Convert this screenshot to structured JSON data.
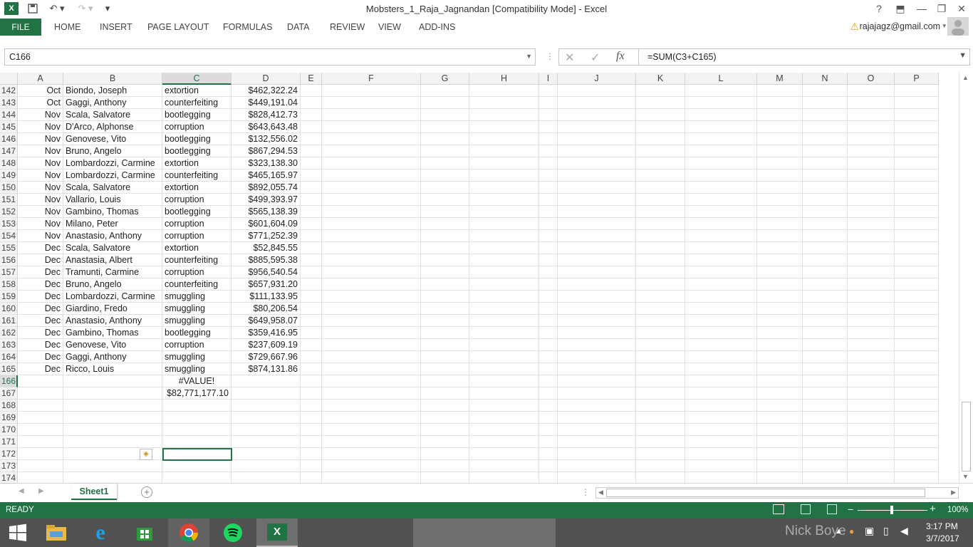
{
  "title_bar": {
    "title": "Mobsters_1_Raja_Jagnandan  [Compatibility Mode] - Excel",
    "help": "?",
    "colors": {
      "accent": "#217346"
    }
  },
  "ribbon": {
    "file_label": "FILE",
    "tabs": [
      "HOME",
      "INSERT",
      "PAGE LAYOUT",
      "FORMULAS",
      "DATA",
      "REVIEW",
      "VIEW",
      "ADD-INS"
    ],
    "account": "rajajagz@gmail.com"
  },
  "formula_bar": {
    "name_box": "C166",
    "fx": "fx",
    "formula": "=SUM(C3+C165)"
  },
  "grid": {
    "columns": [
      "A",
      "B",
      "C",
      "D",
      "E",
      "F",
      "G",
      "H",
      "I",
      "J",
      "K",
      "L",
      "M",
      "N",
      "O",
      "P"
    ],
    "selected_column": "C",
    "rows": [
      {
        "num": "142",
        "a": "Oct",
        "b": "Biondo, Joseph",
        "c": "extortion",
        "d": "$462,322.24"
      },
      {
        "num": "143",
        "a": "Oct",
        "b": "Gaggi, Anthony",
        "c": "counterfeiting",
        "d": "$449,191.04"
      },
      {
        "num": "144",
        "a": "Nov",
        "b": "Scala, Salvatore",
        "c": "bootlegging",
        "d": "$828,412.73"
      },
      {
        "num": "145",
        "a": "Nov",
        "b": "D'Arco, Alphonse",
        "c": "corruption",
        "d": "$643,643.48"
      },
      {
        "num": "146",
        "a": "Nov",
        "b": "Genovese, Vito",
        "c": "bootlegging",
        "d": "$132,556.02"
      },
      {
        "num": "147",
        "a": "Nov",
        "b": "Bruno, Angelo",
        "c": "bootlegging",
        "d": "$867,294.53"
      },
      {
        "num": "148",
        "a": "Nov",
        "b": "Lombardozzi, Carmine",
        "c": "extortion",
        "d": "$323,138.30"
      },
      {
        "num": "149",
        "a": "Nov",
        "b": "Lombardozzi, Carmine",
        "c": "counterfeiting",
        "d": "$465,165.97"
      },
      {
        "num": "150",
        "a": "Nov",
        "b": "Scala, Salvatore",
        "c": "extortion",
        "d": "$892,055.74"
      },
      {
        "num": "151",
        "a": "Nov",
        "b": "Vallario, Louis",
        "c": "corruption",
        "d": "$499,393.97"
      },
      {
        "num": "152",
        "a": "Nov",
        "b": "Gambino, Thomas",
        "c": "bootlegging",
        "d": "$565,138.39"
      },
      {
        "num": "153",
        "a": "Nov",
        "b": "Milano, Peter",
        "c": "corruption",
        "d": "$601,604.09"
      },
      {
        "num": "154",
        "a": "Nov",
        "b": "Anastasio, Anthony",
        "c": "corruption",
        "d": "$771,252.39"
      },
      {
        "num": "155",
        "a": "Dec",
        "b": "Scala, Salvatore",
        "c": "extortion",
        "d": "$52,845.55"
      },
      {
        "num": "156",
        "a": "Dec",
        "b": "Anastasia, Albert",
        "c": "counterfeiting",
        "d": "$885,595.38"
      },
      {
        "num": "157",
        "a": "Dec",
        "b": "Tramunti, Carmine",
        "c": "corruption",
        "d": "$956,540.54"
      },
      {
        "num": "158",
        "a": "Dec",
        "b": "Bruno, Angelo",
        "c": "counterfeiting",
        "d": "$657,931.20"
      },
      {
        "num": "159",
        "a": "Dec",
        "b": "Lombardozzi, Carmine",
        "c": "smuggling",
        "d": "$111,133.95"
      },
      {
        "num": "160",
        "a": "Dec",
        "b": "Giardino, Fredo",
        "c": "smuggling",
        "d": "$80,206.54"
      },
      {
        "num": "161",
        "a": "Dec",
        "b": "Anastasio, Anthony",
        "c": "smuggling",
        "d": "$649,958.07"
      },
      {
        "num": "162",
        "a": "Dec",
        "b": "Gambino, Thomas",
        "c": "bootlegging",
        "d": "$359,416.95"
      },
      {
        "num": "163",
        "a": "Dec",
        "b": "Genovese, Vito",
        "c": "corruption",
        "d": "$237,609.19"
      },
      {
        "num": "164",
        "a": "Dec",
        "b": "Gaggi, Anthony",
        "c": "smuggling",
        "d": "$729,667.96"
      },
      {
        "num": "165",
        "a": "Dec",
        "b": "Ricco, Louis",
        "c": "smuggling",
        "d": "$874,131.86"
      },
      {
        "num": "166",
        "a": "",
        "b": "",
        "c": "#VALUE!",
        "d": ""
      },
      {
        "num": "167",
        "a": "",
        "b": "",
        "c": "$82,771,177.10",
        "d": ""
      },
      {
        "num": "168",
        "a": "",
        "b": "",
        "c": "",
        "d": ""
      },
      {
        "num": "169",
        "a": "",
        "b": "",
        "c": "",
        "d": ""
      },
      {
        "num": "170",
        "a": "",
        "b": "",
        "c": "",
        "d": ""
      },
      {
        "num": "171",
        "a": "",
        "b": "",
        "c": "",
        "d": ""
      },
      {
        "num": "172",
        "a": "",
        "b": "",
        "c": "",
        "d": ""
      },
      {
        "num": "173",
        "a": "",
        "b": "",
        "c": "",
        "d": ""
      },
      {
        "num": "174",
        "a": "",
        "b": "",
        "c": "",
        "d": ""
      }
    ],
    "selected_row": "166"
  },
  "sheet_tabs": {
    "active": "Sheet1",
    "add_icon": "plus-icon"
  },
  "status_bar": {
    "status": "READY",
    "zoom": "100%"
  },
  "taskbar": {
    "apps": [
      "start-icon",
      "file-explorer-icon",
      "internet-explorer-icon",
      "store-icon",
      "chrome-icon",
      "spotify-icon",
      "excel-icon"
    ],
    "user_watermark": "Nick Boye",
    "time": "3:17 PM",
    "date": "3/7/2017"
  }
}
